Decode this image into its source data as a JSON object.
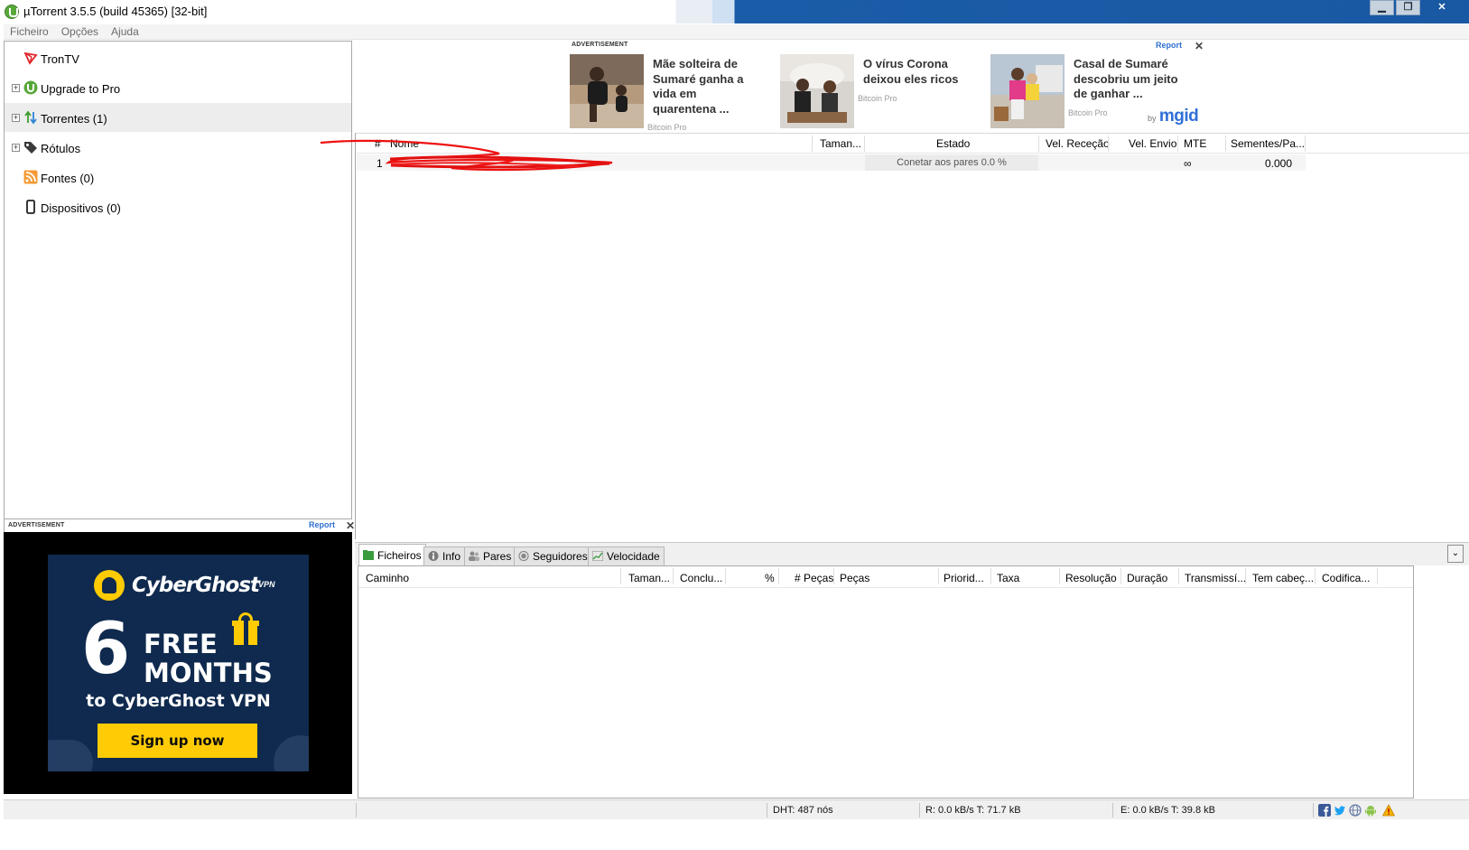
{
  "window": {
    "title": "µTorrent 3.5.5  (build 45365) [32-bit]",
    "minimize": "▁",
    "maximize": "❐",
    "close": "✕"
  },
  "menu": [
    "Ficheiro",
    "Opções",
    "Ajuda"
  ],
  "sidebar": {
    "items": [
      {
        "label": "TronTV",
        "icon": "tron-icon",
        "expandable": false
      },
      {
        "label": "Upgrade to Pro",
        "icon": "utorrent-icon",
        "expandable": true
      },
      {
        "label": "Torrentes (1)",
        "icon": "torrents-arrows-icon",
        "expandable": true
      },
      {
        "label": "Rótulos",
        "icon": "tag-icon",
        "expandable": true
      },
      {
        "label": "Fontes (0)",
        "icon": "rss-icon",
        "expandable": false
      },
      {
        "label": "Dispositivos (0)",
        "icon": "device-icon",
        "expandable": false
      }
    ],
    "expander_symbol": "+"
  },
  "ad_left": {
    "advertisement_label": "ADVERTISEMENT",
    "report_label": "Report",
    "close": "✕",
    "brand": "CyberGhost",
    "brand_suffix": "VPN",
    "big_number": "6",
    "free": "FREE",
    "months": "MONTHS",
    "subline": "to CyberGhost VPN",
    "cta": "Sign up now"
  },
  "ad_top": {
    "advertisement_label": "ADVERTISEMENT",
    "report_label": "Report",
    "close": "✕",
    "items": [
      {
        "title": "Mãe solteira de Sumaré ganha a vida em quarentena ...",
        "source": "Bitcoin Pro"
      },
      {
        "title": "O vírus Corona deixou eles ricos",
        "source": "Bitcoin Pro"
      },
      {
        "title": "Casal de Sumaré descobriu um jeito de ganhar ...",
        "source": "Bitcoin Pro"
      }
    ],
    "by": "by",
    "network": "mgid"
  },
  "torrent_list": {
    "columns": [
      "#",
      "Nome",
      "Taman...",
      "Estado",
      "Vel. Receção",
      "Vel. Envio",
      "MTE",
      "Sementes/Pa..."
    ],
    "rows": [
      {
        "index": "1",
        "name": "",
        "size": "",
        "status": "Conetar aos pares 0.0 %",
        "down": "",
        "up": "",
        "eta": "∞",
        "ratio": "0.000"
      }
    ]
  },
  "detail": {
    "tabs": [
      {
        "label": "Ficheiros",
        "icon": "files-icon",
        "active": true
      },
      {
        "label": "Info",
        "icon": "info-icon",
        "active": false
      },
      {
        "label": "Pares",
        "icon": "peers-icon",
        "active": false
      },
      {
        "label": "Seguidores",
        "icon": "trackers-icon",
        "active": false
      },
      {
        "label": "Velocidade",
        "icon": "speed-graph-icon",
        "active": false
      }
    ],
    "dropdown": "⌄",
    "columns": [
      "Caminho",
      "Taman...",
      "Conclu...",
      "%",
      "# Peças",
      "Peças",
      "Priorid...",
      "Taxa",
      "Resolução",
      "Duração",
      "Transmissí...",
      "Tem cabeç...",
      "Codifica..."
    ]
  },
  "statusbar": {
    "dht": "DHT: 487 nós",
    "download": "R: 0.0 kB/s T: 71.7 kB",
    "upload": "E: 0.0 kB/s T: 39.8 kB",
    "icons": [
      "facebook-icon",
      "twitter-icon",
      "web-icon",
      "android-icon",
      "warning-icon"
    ]
  }
}
